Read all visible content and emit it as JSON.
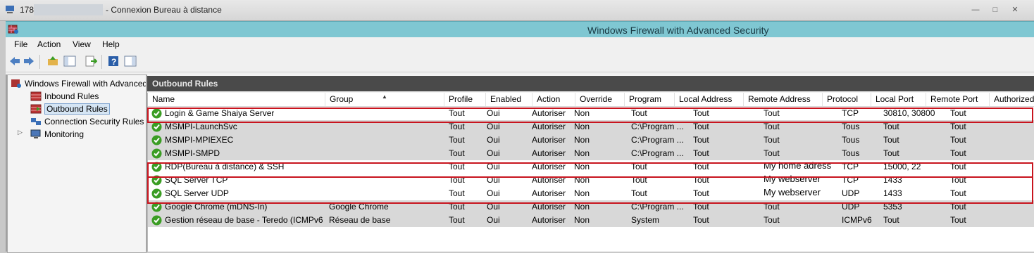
{
  "rdp": {
    "ip_prefix": "178.",
    "title": "- Connexion Bureau à distance"
  },
  "window": {
    "title": "Windows Firewall with Advanced Security"
  },
  "menu": [
    "File",
    "Action",
    "View",
    "Help"
  ],
  "tree": {
    "root": "Windows Firewall with Advanced Security",
    "items": [
      {
        "label": "Inbound Rules"
      },
      {
        "label": "Outbound Rules"
      },
      {
        "label": "Connection Security Rules"
      },
      {
        "label": "Monitoring"
      }
    ]
  },
  "pane": {
    "header": "Outbound Rules"
  },
  "columns": [
    "Name",
    "Group",
    "Profile",
    "Enabled",
    "Action",
    "Override",
    "Program",
    "Local Address",
    "Remote Address",
    "Protocol",
    "Local Port",
    "Remote Port",
    "Authorized"
  ],
  "rows": [
    {
      "name": "Login & Game Shaiya Server",
      "group": "",
      "profile": "Tout",
      "enabled": "Oui",
      "action": "Autoriser",
      "override": "Non",
      "program": "Tout",
      "local_address": "Tout",
      "remote_address": "Tout",
      "protocol": "TCP",
      "local_port": "30810, 30800",
      "remote_port": "Tout",
      "dim": false
    },
    {
      "name": "MSMPI-LaunchSvc",
      "group": "",
      "profile": "Tout",
      "enabled": "Oui",
      "action": "Autoriser",
      "override": "Non",
      "program": "C:\\Program ...",
      "local_address": "Tout",
      "remote_address": "Tout",
      "protocol": "Tous",
      "local_port": "Tout",
      "remote_port": "Tout",
      "dim": true
    },
    {
      "name": "MSMPI-MPIEXEC",
      "group": "",
      "profile": "Tout",
      "enabled": "Oui",
      "action": "Autoriser",
      "override": "Non",
      "program": "C:\\Program ...",
      "local_address": "Tout",
      "remote_address": "Tout",
      "protocol": "Tous",
      "local_port": "Tout",
      "remote_port": "Tout",
      "dim": true
    },
    {
      "name": "MSMPI-SMPD",
      "group": "",
      "profile": "Tout",
      "enabled": "Oui",
      "action": "Autoriser",
      "override": "Non",
      "program": "C:\\Program ...",
      "local_address": "Tout",
      "remote_address": "Tout",
      "protocol": "Tous",
      "local_port": "Tout",
      "remote_port": "Tout",
      "dim": true
    },
    {
      "name": "RDP(Bureau à distance) & SSH",
      "group": "",
      "profile": "Tout",
      "enabled": "Oui",
      "action": "Autoriser",
      "override": "Non",
      "program": "Tout",
      "local_address": "Tout",
      "remote_address": "My home adress",
      "protocol": "TCP",
      "local_port": "15000, 22",
      "remote_port": "Tout",
      "dim": false
    },
    {
      "name": "SQL Server TCP",
      "group": "",
      "profile": "Tout",
      "enabled": "Oui",
      "action": "Autoriser",
      "override": "Non",
      "program": "Tout",
      "local_address": "Tout",
      "remote_address": "My webserver",
      "protocol": "TCP",
      "local_port": "1433",
      "remote_port": "Tout",
      "dim": false
    },
    {
      "name": "SQL Server UDP",
      "group": "",
      "profile": "Tout",
      "enabled": "Oui",
      "action": "Autoriser",
      "override": "Non",
      "program": "Tout",
      "local_address": "Tout",
      "remote_address": "My webserver",
      "protocol": "UDP",
      "local_port": "1433",
      "remote_port": "Tout",
      "dim": false
    },
    {
      "name": "Google Chrome (mDNS-In)",
      "group": "Google Chrome",
      "profile": "Tout",
      "enabled": "Oui",
      "action": "Autoriser",
      "override": "Non",
      "program": "C:\\Program ...",
      "local_address": "Tout",
      "remote_address": "Tout",
      "protocol": "UDP",
      "local_port": "5353",
      "remote_port": "Tout",
      "dim": true
    },
    {
      "name": "Gestion réseau de base - Teredo (ICMPv6...",
      "group": "Réseau de base",
      "profile": "Tout",
      "enabled": "Oui",
      "action": "Autoriser",
      "override": "Non",
      "program": "System",
      "local_address": "Tout",
      "remote_address": "Tout",
      "protocol": "ICMPv6",
      "local_port": "Tout",
      "remote_port": "Tout",
      "dim": true
    }
  ],
  "colors": {
    "highlight": "#c8141e",
    "titlebar": "#7fc7d2",
    "pane_header": "#4a4a4a",
    "dim_row": "#d8d8d8",
    "check": "#3a9d23"
  }
}
